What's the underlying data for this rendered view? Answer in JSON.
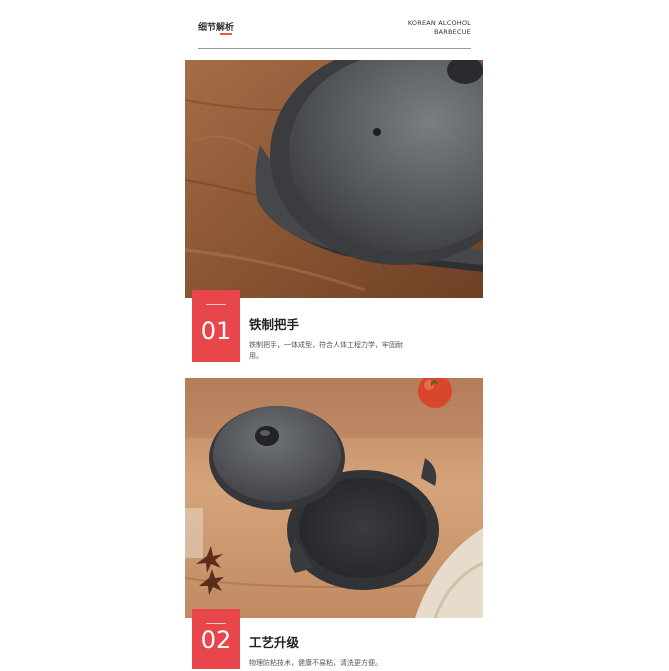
{
  "header": {
    "section_title": "细节解析",
    "brand_line1": "KOREAN ALCOHOL",
    "brand_line2": "BARBECUE"
  },
  "features": [
    {
      "number": "01",
      "title": "铁制把手",
      "description": "铁制把手，一体成型，符合人体工程力学，牢固耐用。"
    },
    {
      "number": "02",
      "title": "工艺升级",
      "description": "物理防粘技术，健康不易粘，清洗更方便。"
    }
  ],
  "colors": {
    "accent": "#e8464a",
    "wood": "#8b5a3c",
    "pot": "#4a4c50"
  }
}
